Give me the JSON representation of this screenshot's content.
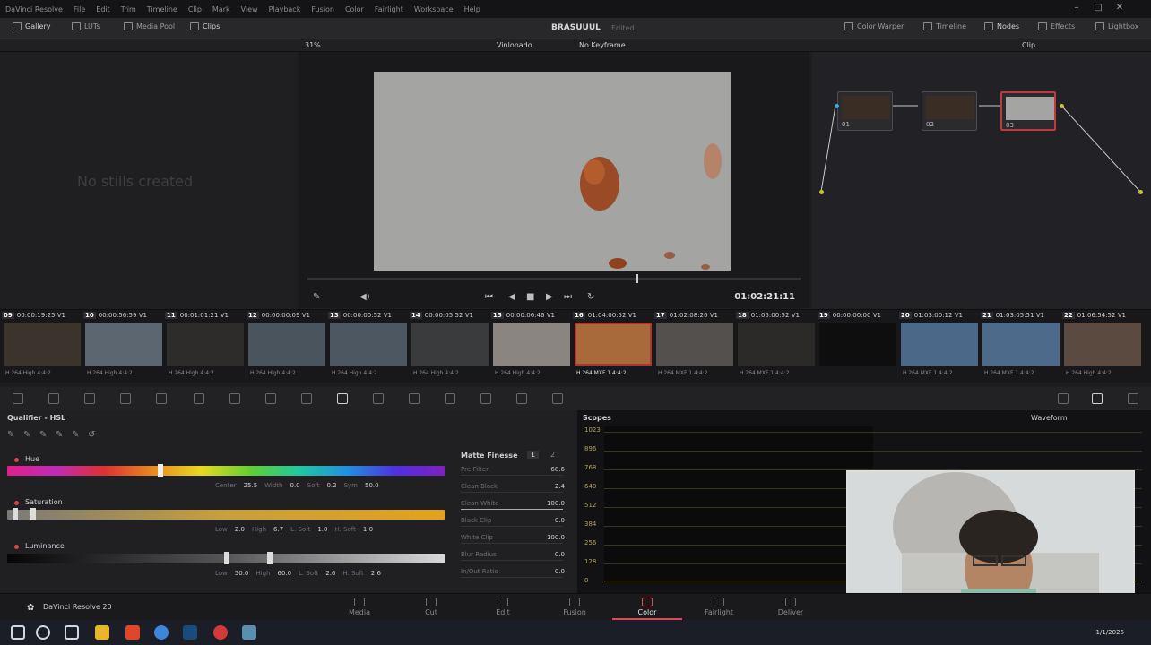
{
  "menubar": {
    "items": [
      "DaVinci Resolve",
      "File",
      "Edit",
      "Trim",
      "Timeline",
      "Clip",
      "Mark",
      "View",
      "Playback",
      "Fusion",
      "Color",
      "Fairlight",
      "Workspace",
      "Help"
    ]
  },
  "toolbar": {
    "gallery": "Gallery",
    "luts": "LUTs",
    "media_pool": "Media Pool",
    "clips": "Clips",
    "project_title": "BRASUUUL",
    "edited": "Edited",
    "color_warper": "Color Warper",
    "timeline": "Timeline",
    "nodes": "Nodes",
    "effects": "Effects",
    "lightbox": "Lightbox"
  },
  "viewer": {
    "zoom": "31%",
    "clip_name": "Vinlonado",
    "keyframe": "No Keyframe",
    "timecode": "01:02:21:11"
  },
  "nodes_panel": {
    "mode": "Clip",
    "node_label_1": "01",
    "node_label_2": "02",
    "node_label_3": "03"
  },
  "gallery": {
    "empty_text": "No stills created"
  },
  "clips": [
    {
      "num": "09",
      "tc": "00:00:19:25",
      "track": "V1",
      "codec": "H.264 High 4:4:2"
    },
    {
      "num": "10",
      "tc": "00:00:56:59",
      "track": "V1",
      "codec": "H.264 High 4:4:2"
    },
    {
      "num": "11",
      "tc": "00:01:01:21",
      "track": "V1",
      "codec": "H.264 High 4:4:2"
    },
    {
      "num": "12",
      "tc": "00:00:00:09",
      "track": "V1",
      "codec": "H.264 High 4:4:2"
    },
    {
      "num": "13",
      "tc": "00:00:00:52",
      "track": "V1",
      "codec": "H.264 High 4:4:2"
    },
    {
      "num": "14",
      "tc": "00:00:05:52",
      "track": "V1",
      "codec": "H.264 High 4:4:2"
    },
    {
      "num": "15",
      "tc": "00:00:06:46",
      "track": "V1",
      "codec": "H.264 High 4:4:2"
    },
    {
      "num": "16",
      "tc": "01:04:00:52",
      "track": "V1",
      "codec": "H.264 MXF 1 4:4:2"
    },
    {
      "num": "17",
      "tc": "01:02:08:26",
      "track": "V1",
      "codec": "H.264 MXF 1 4:4:2"
    },
    {
      "num": "18",
      "tc": "01:05:00:52",
      "track": "V1",
      "codec": "H.264 MXF 1 4:4:2"
    },
    {
      "num": "19",
      "tc": "00:00:00:00",
      "track": "V1",
      "codec": ""
    },
    {
      "num": "20",
      "tc": "01:03:00:12",
      "track": "V1",
      "codec": "H.264 MXF 1 4:4:2"
    },
    {
      "num": "21",
      "tc": "01:03:05:51",
      "track": "V1",
      "codec": "H.264 MXF 1 4:4:2"
    },
    {
      "num": "22",
      "tc": "01:06:54:52",
      "track": "V1",
      "codec": "H.264 High 4:4:2"
    }
  ],
  "qualifier": {
    "title": "Qualifier - HSL",
    "hue_label": "Hue",
    "hue_params": {
      "center_l": "Center",
      "center": "25.5",
      "width_l": "Width",
      "width": "0.0",
      "soft_l": "Soft",
      "soft": "0.2",
      "sym_l": "Sym",
      "sym": "50.0"
    },
    "sat_label": "Saturation",
    "sat_params": {
      "low_l": "Low",
      "low": "2.0",
      "high_l": "High",
      "high": "6.7",
      "lsoft_l": "L. Soft",
      "lsoft": "1.0",
      "hsoft_l": "H. Soft",
      "hsoft": "1.0"
    },
    "lum_label": "Luminance",
    "lum_params": {
      "low_l": "Low",
      "low": "50.0",
      "high_l": "High",
      "high": "60.0",
      "lsoft_l": "L. Soft",
      "lsoft": "2.6",
      "hsoft_l": "H. Soft",
      "hsoft": "2.6"
    }
  },
  "matte": {
    "title": "Matte Finesse",
    "tab1": "1",
    "tab2": "2",
    "rows": [
      {
        "label": "Pre-Filter",
        "value": "68.6"
      },
      {
        "label": "Clean Black",
        "value": "2.4"
      },
      {
        "label": "Clean White",
        "value": "100.0"
      },
      {
        "label": "Black Clip",
        "value": "0.0"
      },
      {
        "label": "White Clip",
        "value": "100.0"
      },
      {
        "label": "Blur Radius",
        "value": "0.0"
      },
      {
        "label": "In/Out Ratio",
        "value": "0.0"
      }
    ]
  },
  "scopes": {
    "title": "Scopes",
    "mode": "Waveform",
    "y_labels": [
      "1023",
      "896",
      "768",
      "640",
      "512",
      "384",
      "256",
      "128",
      "0"
    ]
  },
  "pages": {
    "brand": "DaVinci Resolve 20",
    "tabs": [
      "Media",
      "Cut",
      "Edit",
      "Fusion",
      "Color",
      "Fairlight",
      "Deliver"
    ],
    "active": "Color"
  },
  "taskbar": {
    "clock": "1/1/2026"
  },
  "colors": {
    "accent": "#e0475a",
    "selected_node": "#c0393f",
    "scope_trace": "#b3a25c"
  }
}
